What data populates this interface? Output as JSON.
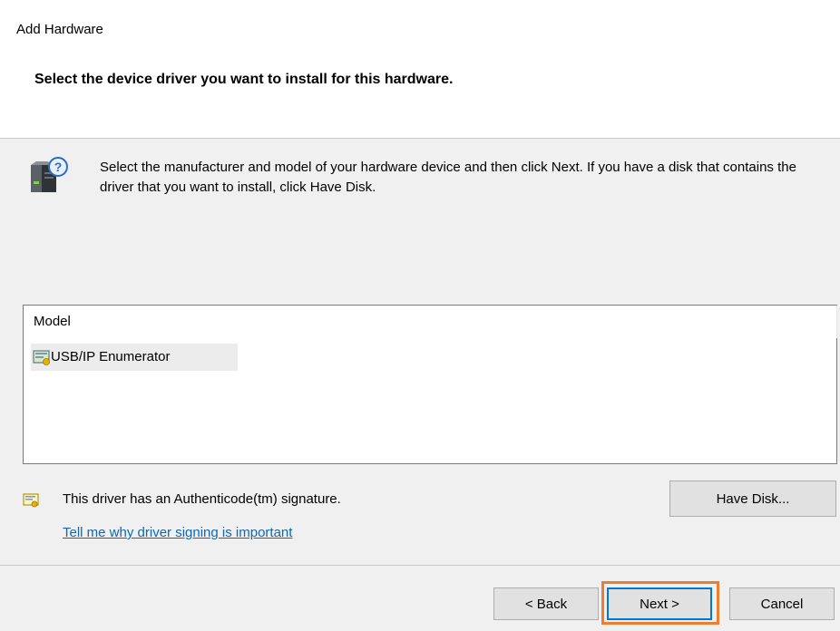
{
  "window": {
    "title": "Add Hardware",
    "heading": "Select the device driver you want to install for this hardware."
  },
  "instructions": {
    "icon": "hardware-help-icon",
    "text": "Select the manufacturer and model of your hardware device and then click Next. If you have a disk that contains the driver that you want to install, click Have Disk."
  },
  "model_list": {
    "column_header": "Model",
    "items": [
      {
        "label": "USB/IP Enumerator",
        "icon": "driver-device-icon",
        "selected": true
      }
    ]
  },
  "signature": {
    "icon": "certificate-icon",
    "text": "This driver has an Authenticode(tm) signature.",
    "link": "Tell me why driver signing is important"
  },
  "buttons": {
    "have_disk": "Have Disk...",
    "back": "< Back",
    "next": "Next >",
    "cancel": "Cancel"
  },
  "colors": {
    "content_background": "#f0f0f0",
    "link": "#1068b0",
    "highlight_border": "#ed7d31",
    "default_button_border": "#0078d7"
  }
}
